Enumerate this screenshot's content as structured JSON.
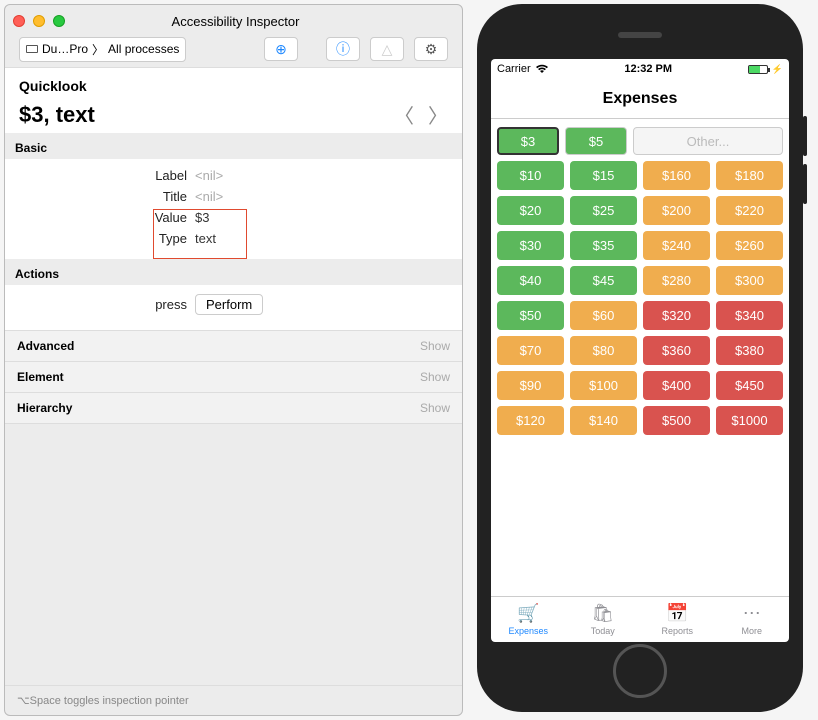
{
  "inspector": {
    "window_title": "Accessibility Inspector",
    "crumb_device": "Du…Pro",
    "crumb_target": "All processes",
    "quicklook_heading": "Quicklook",
    "target_summary": "$3, text",
    "sections": {
      "basic": "Basic",
      "actions": "Actions",
      "advanced": "Advanced",
      "element": "Element",
      "hierarchy": "Hierarchy"
    },
    "basic": {
      "label_key": "Label",
      "label_val": "<nil>",
      "title_key": "Title",
      "title_val": "<nil>",
      "value_key": "Value",
      "value_val": "$3",
      "type_key": "Type",
      "type_val": "text"
    },
    "actions": {
      "press_key": "press",
      "perform_btn": "Perform"
    },
    "show": "Show",
    "footer": "⌥Space toggles inspection pointer"
  },
  "phone": {
    "carrier": "Carrier",
    "time": "12:32 PM",
    "nav_title": "Expenses",
    "top_row": {
      "seg1": "$3",
      "seg2": "$5",
      "other": "Other..."
    },
    "rows": [
      [
        {
          "l": "$10",
          "c": "g"
        },
        {
          "l": "$15",
          "c": "g"
        },
        {
          "l": "$160",
          "c": "o"
        },
        {
          "l": "$180",
          "c": "o"
        }
      ],
      [
        {
          "l": "$20",
          "c": "g"
        },
        {
          "l": "$25",
          "c": "g"
        },
        {
          "l": "$200",
          "c": "o"
        },
        {
          "l": "$220",
          "c": "o"
        }
      ],
      [
        {
          "l": "$30",
          "c": "g"
        },
        {
          "l": "$35",
          "c": "g"
        },
        {
          "l": "$240",
          "c": "o"
        },
        {
          "l": "$260",
          "c": "o"
        }
      ],
      [
        {
          "l": "$40",
          "c": "g"
        },
        {
          "l": "$45",
          "c": "g"
        },
        {
          "l": "$280",
          "c": "o"
        },
        {
          "l": "$300",
          "c": "o"
        }
      ],
      [
        {
          "l": "$50",
          "c": "g"
        },
        {
          "l": "$60",
          "c": "o"
        },
        {
          "l": "$320",
          "c": "r"
        },
        {
          "l": "$340",
          "c": "r"
        }
      ],
      [
        {
          "l": "$70",
          "c": "o"
        },
        {
          "l": "$80",
          "c": "o"
        },
        {
          "l": "$360",
          "c": "r"
        },
        {
          "l": "$380",
          "c": "r"
        }
      ],
      [
        {
          "l": "$90",
          "c": "o"
        },
        {
          "l": "$100",
          "c": "o"
        },
        {
          "l": "$400",
          "c": "r"
        },
        {
          "l": "$450",
          "c": "r"
        }
      ],
      [
        {
          "l": "$120",
          "c": "o"
        },
        {
          "l": "$140",
          "c": "o"
        },
        {
          "l": "$500",
          "c": "r"
        },
        {
          "l": "$1000",
          "c": "r"
        }
      ]
    ],
    "tabs": {
      "expenses": "Expenses",
      "today": "Today",
      "reports": "Reports",
      "more": "More"
    }
  }
}
